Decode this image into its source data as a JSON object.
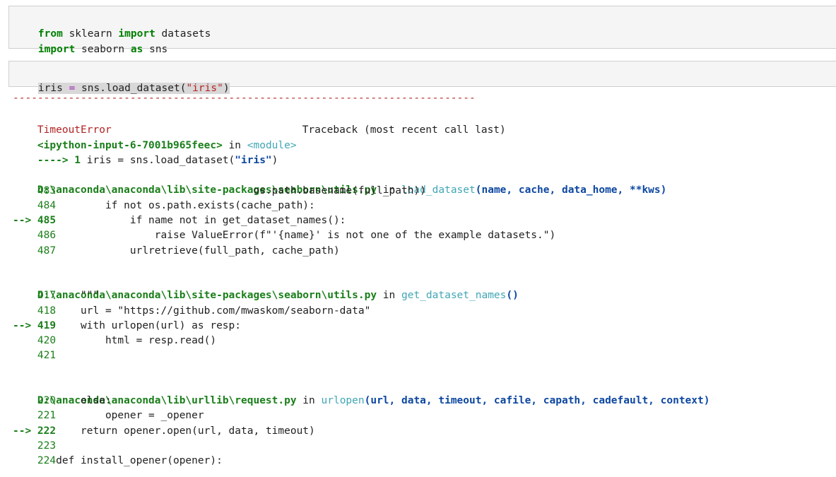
{
  "cell1": {
    "line1": {
      "kw1": "from",
      "mod": " sklearn ",
      "kw2": "import",
      "rest": " datasets"
    },
    "line2": {
      "kw1": "import",
      "mod": " seaborn ",
      "kw2": "as",
      "rest": " sns"
    }
  },
  "cell2": {
    "var": "iris",
    "eq": " = ",
    "call": "sns.load_dataset(",
    "arg": "\"iris\"",
    "close": ")"
  },
  "traceback": {
    "dashes": "---------------------------------------------------------------------------",
    "error_name": "TimeoutError",
    "traceback_label": "Traceback (most recent call last)",
    "input_ref": "<ipython-input-6-7001b965feec>",
    "in_word": " in ",
    "module_ref": "<module>",
    "arrow_line": {
      "arrow": "----> 1 ",
      "code": "iris = sns.load_dataset(",
      "arg": "\"iris\"",
      "close": ")"
    },
    "frame1": {
      "path": "D:\\anaconda\\anaconda\\lib\\site-packages\\seaborn\\utils.py",
      "in_word": " in ",
      "func": "load_dataset",
      "sig": "(name, cache, data_home, **kws)",
      "lines": [
        {
          "no": "    483",
          "code": "                                os.path.basename(full_path))"
        },
        {
          "no": "    484",
          "code": "        if not os.path.exists(cache_path):"
        },
        {
          "no": "--> 485",
          "code": "            if name not in get_dataset_names():"
        },
        {
          "no": "    486",
          "code": "                raise ValueError(f\"'{name}' is not one of the example datasets.\")"
        },
        {
          "no": "    487",
          "code": "            urlretrieve(full_path, cache_path)"
        }
      ]
    },
    "frame2": {
      "path": "D:\\anaconda\\anaconda\\lib\\site-packages\\seaborn\\utils.py",
      "in_word": " in ",
      "func": "get_dataset_names",
      "sig": "()",
      "lines": [
        {
          "no": "    417",
          "code": "    \"\"\""
        },
        {
          "no": "    418",
          "code": "    url = \"https://github.com/mwaskom/seaborn-data\""
        },
        {
          "no": "--> 419",
          "code": "    with urlopen(url) as resp:"
        },
        {
          "no": "    420",
          "code": "        html = resp.read()"
        },
        {
          "no": "    421",
          "code": ""
        }
      ]
    },
    "frame3": {
      "path": "D:\\anaconda\\anaconda\\lib\\urllib\\request.py",
      "in_word": " in ",
      "func": "urlopen",
      "sig": "(url, data, timeout, cafile, capath, cadefault, context)",
      "lines": [
        {
          "no": "    220",
          "code": "    else:"
        },
        {
          "no": "    221",
          "code": "        opener = _opener"
        },
        {
          "no": "--> 222",
          "code": "    return opener.open(url, data, timeout)"
        },
        {
          "no": "    223",
          "code": ""
        },
        {
          "no": "    224",
          "code": "def install_opener(opener):"
        }
      ]
    }
  }
}
